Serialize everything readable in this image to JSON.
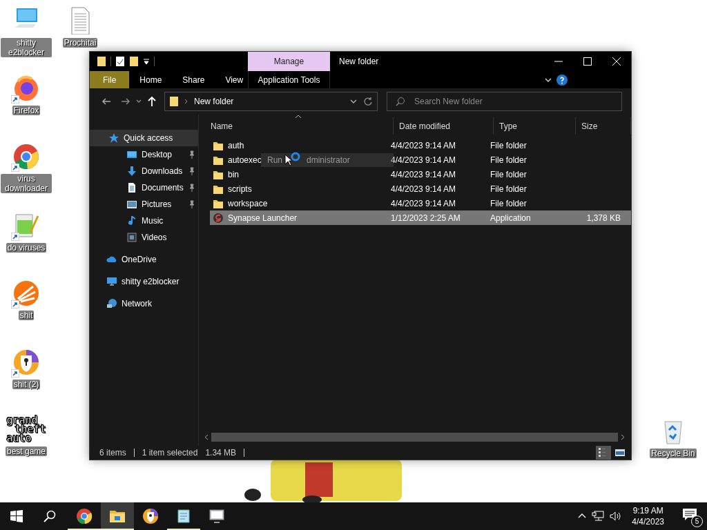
{
  "desktop_icons": [
    {
      "label": "shitty e2blocker",
      "kind": "computer",
      "shortcut": false
    },
    {
      "label": "Prochitai",
      "kind": "document",
      "shortcut": false
    },
    {
      "label": "Firefox",
      "kind": "firefox",
      "shortcut": true
    },
    {
      "label": "virus downloader",
      "kind": "chrome",
      "shortcut": true
    },
    {
      "label": "do viruses",
      "kind": "notepad",
      "shortcut": true
    },
    {
      "label": "shit",
      "kind": "orange-app",
      "shortcut": true
    },
    {
      "label": "shit (2)",
      "kind": "shield",
      "shortcut": true
    },
    {
      "label": "best game",
      "kind": "logo",
      "shortcut": false,
      "logo_lines": [
        "grand",
        "theft",
        "auto"
      ]
    },
    {
      "label": "Recycle Bin",
      "kind": "recycle-bin",
      "shortcut": false
    }
  ],
  "window": {
    "title": "New folder",
    "context_header": "Manage",
    "ribbon_tabs": [
      {
        "label": "File",
        "kind": "file"
      },
      {
        "label": "Home",
        "kind": "tab"
      },
      {
        "label": "Share",
        "kind": "tab"
      },
      {
        "label": "View",
        "kind": "tab"
      },
      {
        "label": "Application Tools",
        "kind": "context"
      }
    ],
    "address": {
      "path": "New folder"
    },
    "search": {
      "placeholder": "Search New folder"
    },
    "nav": [
      {
        "label": "Quick access",
        "kind": "star",
        "selected": true,
        "pinned": false,
        "children": [
          {
            "label": "Desktop",
            "kind": "desktop",
            "selected": false,
            "pinned": true
          },
          {
            "label": "Downloads",
            "kind": "download",
            "selected": false,
            "pinned": true
          },
          {
            "label": "Documents",
            "kind": "document",
            "selected": false,
            "pinned": true
          },
          {
            "label": "Pictures",
            "kind": "pictures",
            "selected": false,
            "pinned": true
          },
          {
            "label": "Music",
            "kind": "music",
            "selected": false,
            "pinned": false
          },
          {
            "label": "Videos",
            "kind": "videos",
            "selected": false,
            "pinned": false
          }
        ]
      },
      {
        "label": "OneDrive",
        "kind": "cloud",
        "selected": false,
        "pinned": false
      },
      {
        "label": "shitty e2blocker",
        "kind": "computer",
        "selected": false,
        "pinned": false
      },
      {
        "label": "Network",
        "kind": "network",
        "selected": false,
        "pinned": false
      }
    ],
    "columns": [
      "Name",
      "Date modified",
      "Type",
      "Size"
    ],
    "rows": [
      {
        "name": "auth",
        "kind": "folder",
        "date": "4/4/2023 9:14 AM",
        "type": "File folder",
        "selected": false
      },
      {
        "name": "autoexec",
        "kind": "folder",
        "date": "4/4/2023 9:14 AM",
        "type": "File folder",
        "selected": false
      },
      {
        "name": "bin",
        "kind": "folder",
        "date": "4/4/2023 9:14 AM",
        "type": "File folder",
        "selected": false
      },
      {
        "name": "scripts",
        "kind": "folder",
        "date": "4/4/2023 9:14 AM",
        "type": "File folder",
        "selected": false
      },
      {
        "name": "workspace",
        "kind": "folder",
        "date": "4/4/2023 9:14 AM",
        "type": "File folder",
        "selected": false
      },
      {
        "name": "Synapse Launcher",
        "kind": "application",
        "date": "1/12/2023 2:25 AM",
        "type": "Application",
        "size": "1,378 KB",
        "selected": true
      }
    ],
    "drag_tooltip": {
      "before_pointer": "Run",
      "after_pointer": "dministrator"
    },
    "status": {
      "count": "6 items",
      "selection": "1 item selected",
      "selection_size": "1.34 MB"
    },
    "view_modes": [
      {
        "kind": "details",
        "selected": true
      },
      {
        "kind": "large-icons",
        "selected": false
      }
    ]
  },
  "taskbar": {
    "apps": [
      {
        "kind": "chrome",
        "running": true,
        "active": false
      },
      {
        "kind": "explorer",
        "running": true,
        "active": true
      },
      {
        "kind": "shield",
        "running": false,
        "active": false
      },
      {
        "kind": "notepad",
        "running": true,
        "active": false
      },
      {
        "kind": "monitor-app",
        "running": false,
        "active": false
      }
    ],
    "time": "9:19 AM",
    "date": "4/4/2023",
    "notification_count": "5"
  }
}
